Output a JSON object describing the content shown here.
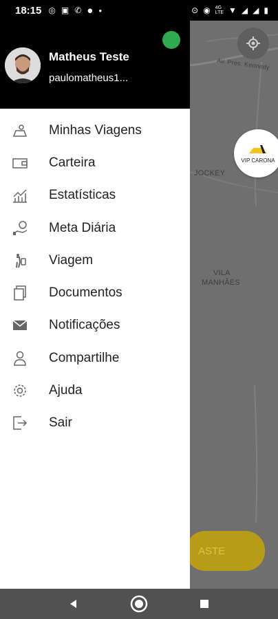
{
  "status_bar": {
    "time": "18:15"
  },
  "user": {
    "name": "Matheus Teste",
    "email": "paulomatheus1..."
  },
  "menu": {
    "items": [
      {
        "label": "Minhas Viagens",
        "icon": "trips-icon"
      },
      {
        "label": "Carteira",
        "icon": "wallet-icon"
      },
      {
        "label": "Estatísticas",
        "icon": "chart-icon"
      },
      {
        "label": "Meta Diária",
        "icon": "goal-icon"
      },
      {
        "label": "Viagem",
        "icon": "travel-icon"
      },
      {
        "label": "Documentos",
        "icon": "documents-icon"
      },
      {
        "label": "Notificações",
        "icon": "mail-icon"
      },
      {
        "label": "Compartilhe",
        "icon": "user-icon"
      },
      {
        "label": "Ajuda",
        "icon": "help-icon"
      },
      {
        "label": "Sair",
        "icon": "logout-icon"
      }
    ]
  },
  "map": {
    "labels": {
      "road": "Av. Pres. Kennedy",
      "area1": "JOCKEY",
      "area2_line1": "VILA",
      "area2_line2": "MANHÃES"
    },
    "badge_text": "VIP CARONA",
    "cta_partial": "ASTE"
  },
  "colors": {
    "header_bg": "#000000",
    "online": "#2eab4f",
    "cta": "#b89c16",
    "navbar": "#515151"
  }
}
